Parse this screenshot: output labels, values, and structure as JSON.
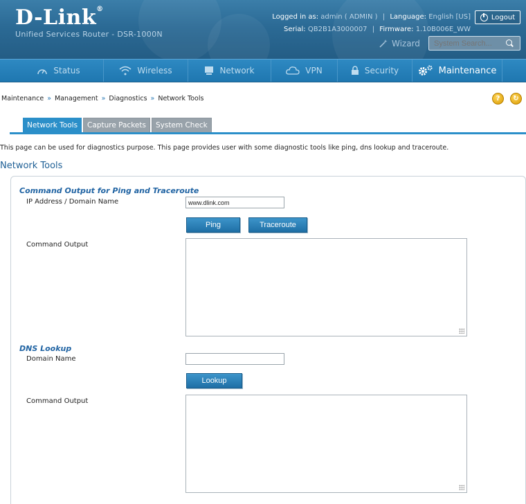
{
  "header": {
    "logo": "D-Link",
    "logo_mark": "®",
    "subtitle": "Unified Services Router - DSR-1000N",
    "logged_in_label": "Logged in as:",
    "logged_in_value": "admin ( ADMIN )",
    "language_label": "Language:",
    "language_value": "English [US]",
    "serial_label": "Serial:",
    "serial_value": "QB2B1A3000007",
    "firmware_label": "Firmware:",
    "firmware_value": "1.10B006E_WW",
    "logout_label": "Logout",
    "wizard_label": "Wizard",
    "search_placeholder": "System Search..."
  },
  "nav": {
    "items": [
      {
        "label": "Status",
        "icon": "speedometer-icon"
      },
      {
        "label": "Wireless",
        "icon": "wifi-icon"
      },
      {
        "label": "Network",
        "icon": "monitor-icon"
      },
      {
        "label": "VPN",
        "icon": "cloud-icon"
      },
      {
        "label": "Security",
        "icon": "lock-icon"
      },
      {
        "label": "Maintenance",
        "icon": "gears-icon"
      }
    ],
    "active": "Maintenance"
  },
  "breadcrumb": [
    "Maintenance",
    "Management",
    "Diagnostics",
    "Network Tools"
  ],
  "breadcrumb_sep": "»",
  "help": {
    "question": "?",
    "refresh": "↻"
  },
  "tabs": [
    {
      "label": "Network Tools",
      "active": true
    },
    {
      "label": "Capture Packets",
      "active": false
    },
    {
      "label": "System Check",
      "active": false
    }
  ],
  "description": "This page can be used for diagnostics purpose. This page provides user with some diagnostic tools like ping, dns lookup and traceroute.",
  "section_title": "Network Tools",
  "ping_group": {
    "title": "Command Output for Ping and Traceroute",
    "ip_label": "IP Address / Domain Name",
    "ip_value": "www.dlink.com",
    "ping_button": "Ping",
    "traceroute_button": "Traceroute",
    "output_label": "Command Output"
  },
  "dns_group": {
    "title": "DNS Lookup",
    "domain_label": "Domain Name",
    "domain_value": "",
    "lookup_button": "Lookup",
    "output_label": "Command Output"
  }
}
